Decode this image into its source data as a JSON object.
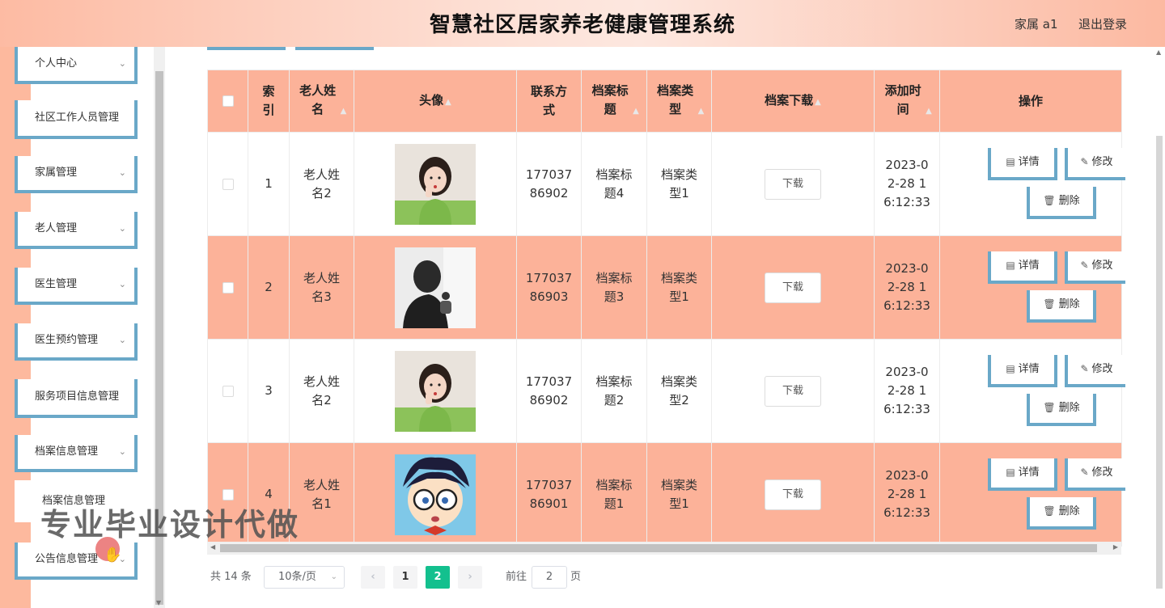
{
  "header": {
    "title": "智慧社区居家养老健康管理系统",
    "user": "家属 a1",
    "logout": "退出登录"
  },
  "sidebar": {
    "items": [
      {
        "label": "个人中心",
        "has_chevron": true
      },
      {
        "label": "社区工作人员管理",
        "has_chevron": false
      },
      {
        "label": "家属管理",
        "has_chevron": true
      },
      {
        "label": "老人管理",
        "has_chevron": true
      },
      {
        "label": "医生管理",
        "has_chevron": true
      },
      {
        "label": "医生预约管理",
        "has_chevron": true
      },
      {
        "label": "服务项目信息管理",
        "has_chevron": false
      },
      {
        "label": "档案信息管理",
        "has_chevron": true
      },
      {
        "label": "公告信息管理",
        "has_chevron": true
      }
    ],
    "submenu": "档案信息管理",
    "chevron": "chevron-down-icon"
  },
  "table": {
    "columns": [
      "索引",
      "老人姓名",
      "头像",
      "联系方式",
      "档案标题",
      "档案类型",
      "档案下载",
      "添加时间",
      "操作"
    ],
    "rows": [
      {
        "index": "1",
        "name": "老人姓名2",
        "avatar": "girl-photo",
        "phone": "17703786902",
        "title": "档案标题4",
        "type": "档案类型1",
        "time": "2023-02-28 16:12:33"
      },
      {
        "index": "2",
        "name": "老人姓名3",
        "avatar": "man-silhouette-photo",
        "phone": "17703786903",
        "title": "档案标题3",
        "type": "档案类型1",
        "time": "2023-02-28 16:12:33"
      },
      {
        "index": "3",
        "name": "老人姓名2",
        "avatar": "girl-photo",
        "phone": "17703786902",
        "title": "档案标题2",
        "type": "档案类型2",
        "time": "2023-02-28 16:12:33"
      },
      {
        "index": "4",
        "name": "老人姓名1",
        "avatar": "cartoon-boy-glasses",
        "phone": "17703786901",
        "title": "档案标题1",
        "type": "档案类型1",
        "time": "2023-02-28 16:12:33"
      }
    ],
    "download_label": "下载",
    "actions": {
      "detail": "详情",
      "edit": "修改",
      "delete": "删除"
    }
  },
  "pagination": {
    "total": "共 14 条",
    "page_size": "10条/页",
    "pages": [
      "1",
      "2"
    ],
    "current": "2",
    "goto_label": "前往",
    "goto_value": "2",
    "page_unit": "页"
  },
  "watermark": "专业毕业设计代做",
  "colors": {
    "accent": "#fcb299",
    "border_blue": "#6aa8c8",
    "active_page": "#13c08e"
  }
}
